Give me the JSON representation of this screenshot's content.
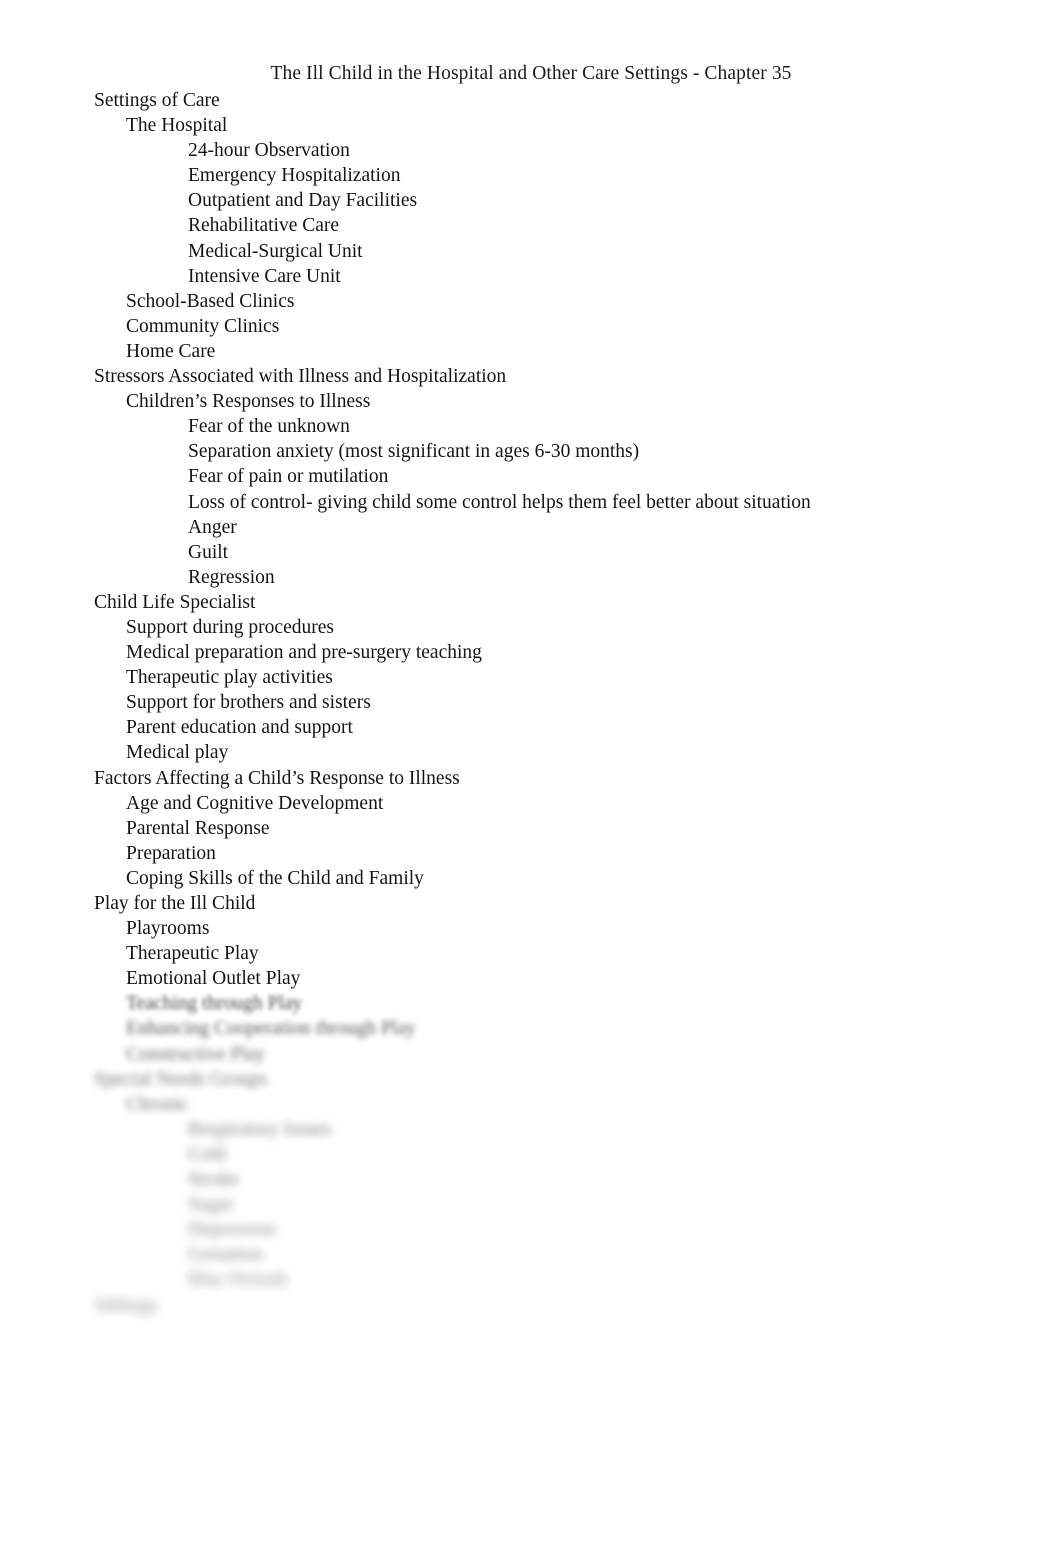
{
  "document": {
    "header": "The Ill Child in the Hospital and Other Care Settings - Chapter 35"
  },
  "outline": [
    {
      "level": 1,
      "text": "Settings of Care",
      "blur": 0
    },
    {
      "level": 2,
      "text": "The Hospital",
      "blur": 0
    },
    {
      "level": 3,
      "text": "24-hour Observation",
      "blur": 0
    },
    {
      "level": 3,
      "text": "Emergency Hospitalization",
      "blur": 0
    },
    {
      "level": 3,
      "text": "Outpatient and Day Facilities",
      "blur": 0
    },
    {
      "level": 3,
      "text": "Rehabilitative Care",
      "blur": 0
    },
    {
      "level": 3,
      "text": "Medical-Surgical Unit",
      "blur": 0
    },
    {
      "level": 3,
      "text": "Intensive Care Unit",
      "blur": 0
    },
    {
      "level": 2,
      "text": "School-Based Clinics",
      "blur": 0
    },
    {
      "level": 2,
      "text": "Community Clinics",
      "blur": 0
    },
    {
      "level": 2,
      "text": "Home Care",
      "blur": 0
    },
    {
      "level": 1,
      "text": "Stressors Associated with Illness and Hospitalization",
      "blur": 0
    },
    {
      "level": 2,
      "text": "Children’s Responses to Illness",
      "blur": 0
    },
    {
      "level": 3,
      "text": "Fear of the unknown",
      "blur": 0
    },
    {
      "level": 3,
      "text": "Separation anxiety (most significant in ages 6-30 months)",
      "blur": 0
    },
    {
      "level": 3,
      "text": "Fear of pain or mutilation",
      "blur": 0
    },
    {
      "level": 3,
      "text": "Loss of control- giving child some control helps them feel better about situation",
      "blur": 0
    },
    {
      "level": 3,
      "text": "Anger",
      "blur": 0
    },
    {
      "level": 3,
      "text": "Guilt",
      "blur": 0
    },
    {
      "level": 3,
      "text": "Regression",
      "blur": 0
    },
    {
      "level": 1,
      "text": "Child Life Specialist",
      "blur": 0
    },
    {
      "level": 2,
      "text": "Support during procedures",
      "blur": 0
    },
    {
      "level": 2,
      "text": "Medical preparation and pre-surgery teaching",
      "blur": 0
    },
    {
      "level": 2,
      "text": "Therapeutic play activities",
      "blur": 0
    },
    {
      "level": 2,
      "text": "Support for brothers and sisters",
      "blur": 0
    },
    {
      "level": 2,
      "text": "Parent education and support",
      "blur": 0
    },
    {
      "level": 2,
      "text": "Medical play",
      "blur": 0
    },
    {
      "level": 1,
      "text": "Factors Affecting a Child’s Response to Illness",
      "blur": 0
    },
    {
      "level": 2,
      "text": "Age and Cognitive Development",
      "blur": 0
    },
    {
      "level": 2,
      "text": "Parental Response",
      "blur": 0
    },
    {
      "level": 2,
      "text": "Preparation",
      "blur": 0
    },
    {
      "level": 2,
      "text": "Coping Skills of the Child and Family",
      "blur": 0
    },
    {
      "level": 1,
      "text": "Play for the Ill Child",
      "blur": 0
    },
    {
      "level": 2,
      "text": "Playrooms",
      "blur": 0
    },
    {
      "level": 2,
      "text": "Therapeutic Play",
      "blur": 0
    },
    {
      "level": 2,
      "text": "Emotional Outlet Play",
      "blur": 0
    },
    {
      "level": 2,
      "text": "Teaching through Play",
      "blur": 1
    },
    {
      "level": 2,
      "text": "Enhancing Cooperation through Play",
      "blur": 2
    },
    {
      "level": 2,
      "text": "Constructive Play",
      "blur": 3
    },
    {
      "level": 1,
      "text": "Special Needs Groups",
      "blur": 4
    },
    {
      "level": 2,
      "text": "Chronic",
      "blur": 4
    },
    {
      "level": 3,
      "text": "Respiratory Issues",
      "blur": 5
    },
    {
      "level": 3,
      "text": "Cold",
      "blur": 5
    },
    {
      "level": 3,
      "text": "Stroke",
      "blur": 5
    },
    {
      "level": 3,
      "text": "Sugar",
      "blur": 6
    },
    {
      "level": 3,
      "text": "Depression",
      "blur": 6
    },
    {
      "level": 3,
      "text": "Gestation",
      "blur": 6
    },
    {
      "level": 3,
      "text": "Blue Periods",
      "blur": 7
    },
    {
      "level": 1,
      "text": "Siblings",
      "blur": 7
    }
  ]
}
